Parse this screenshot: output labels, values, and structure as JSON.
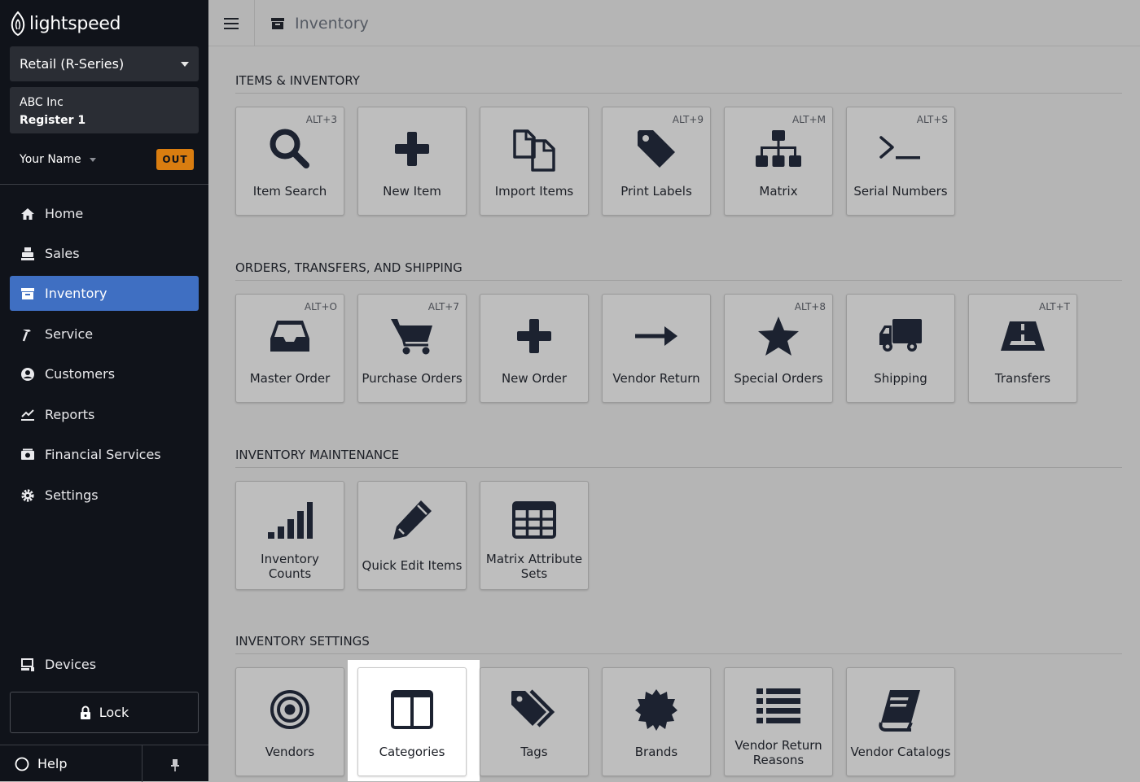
{
  "brand": {
    "name": "lightspeed"
  },
  "account_select": {
    "label": "Retail (R-Series)"
  },
  "company": {
    "name": "ABC Inc",
    "register": "Register 1"
  },
  "user": {
    "name": "Your Name",
    "status_badge": "OUT"
  },
  "nav": [
    {
      "label": "Home",
      "icon": "home-icon"
    },
    {
      "label": "Sales",
      "icon": "register-icon"
    },
    {
      "label": "Inventory",
      "icon": "archive-icon",
      "active": true
    },
    {
      "label": "Service",
      "icon": "hammer-icon"
    },
    {
      "label": "Customers",
      "icon": "user-circle-icon"
    },
    {
      "label": "Reports",
      "icon": "chart-icon"
    },
    {
      "label": "Financial Services",
      "icon": "cash-icon"
    },
    {
      "label": "Settings",
      "icon": "gear-icon"
    }
  ],
  "bottom": {
    "devices": "Devices",
    "lock": "Lock",
    "help": "Help"
  },
  "topbar": {
    "title": "Inventory"
  },
  "colors": {
    "sidebar": "#10131a",
    "active_nav": "#3f6fc2",
    "out_badge": "#d97d10",
    "content_bg": "#b5b5b5"
  },
  "sections": [
    {
      "title": "ITEMS & INVENTORY",
      "tiles": [
        {
          "label": "Item Search",
          "shortcut": "ALT+3",
          "icon": "search-icon"
        },
        {
          "label": "New Item",
          "shortcut": "",
          "icon": "plus-icon"
        },
        {
          "label": "Import Items",
          "shortcut": "",
          "icon": "copy-icon"
        },
        {
          "label": "Print Labels",
          "shortcut": "ALT+9",
          "icon": "tag-icon"
        },
        {
          "label": "Matrix",
          "shortcut": "ALT+M",
          "icon": "sitemap-icon"
        },
        {
          "label": "Serial Numbers",
          "shortcut": "ALT+S",
          "icon": "terminal-icon"
        }
      ]
    },
    {
      "title": "ORDERS, TRANSFERS, AND SHIPPING",
      "tiles": [
        {
          "label": "Master Order",
          "shortcut": "ALT+O",
          "icon": "inbox-icon"
        },
        {
          "label": "Purchase Orders",
          "shortcut": "ALT+7",
          "icon": "cart-icon"
        },
        {
          "label": "New Order",
          "shortcut": "",
          "icon": "plus-icon"
        },
        {
          "label": "Vendor Return",
          "shortcut": "",
          "icon": "arrow-right-icon"
        },
        {
          "label": "Special Orders",
          "shortcut": "ALT+8",
          "icon": "star-icon"
        },
        {
          "label": "Shipping",
          "shortcut": "",
          "icon": "truck-icon"
        },
        {
          "label": "Transfers",
          "shortcut": "ALT+T",
          "icon": "road-icon"
        }
      ]
    },
    {
      "title": "INVENTORY MAINTENANCE",
      "tiles": [
        {
          "label": "Inventory Counts",
          "line1": "Inventory",
          "line2": "Counts",
          "shortcut": "",
          "icon": "signal-icon"
        },
        {
          "label": "Quick Edit Items",
          "shortcut": "",
          "icon": "pencil-icon"
        },
        {
          "label": "Matrix Attribute Sets",
          "line1": "Matrix Attribute",
          "line2": "Sets",
          "shortcut": "",
          "icon": "table-icon"
        }
      ]
    },
    {
      "title": "INVENTORY SETTINGS",
      "tiles": [
        {
          "label": "Vendors",
          "shortcut": "",
          "icon": "bullseye-icon"
        },
        {
          "label": "Categories",
          "shortcut": "",
          "icon": "columns-icon",
          "highlighted": true
        },
        {
          "label": "Tags",
          "shortcut": "",
          "icon": "tags-icon"
        },
        {
          "label": "Brands",
          "shortcut": "",
          "icon": "certificate-icon"
        },
        {
          "label": "Vendor Return Reasons",
          "line1": "Vendor Return",
          "line2": "Reasons",
          "shortcut": "",
          "icon": "list-icon"
        },
        {
          "label": "Vendor Catalogs",
          "shortcut": "",
          "icon": "book-icon"
        }
      ]
    }
  ]
}
